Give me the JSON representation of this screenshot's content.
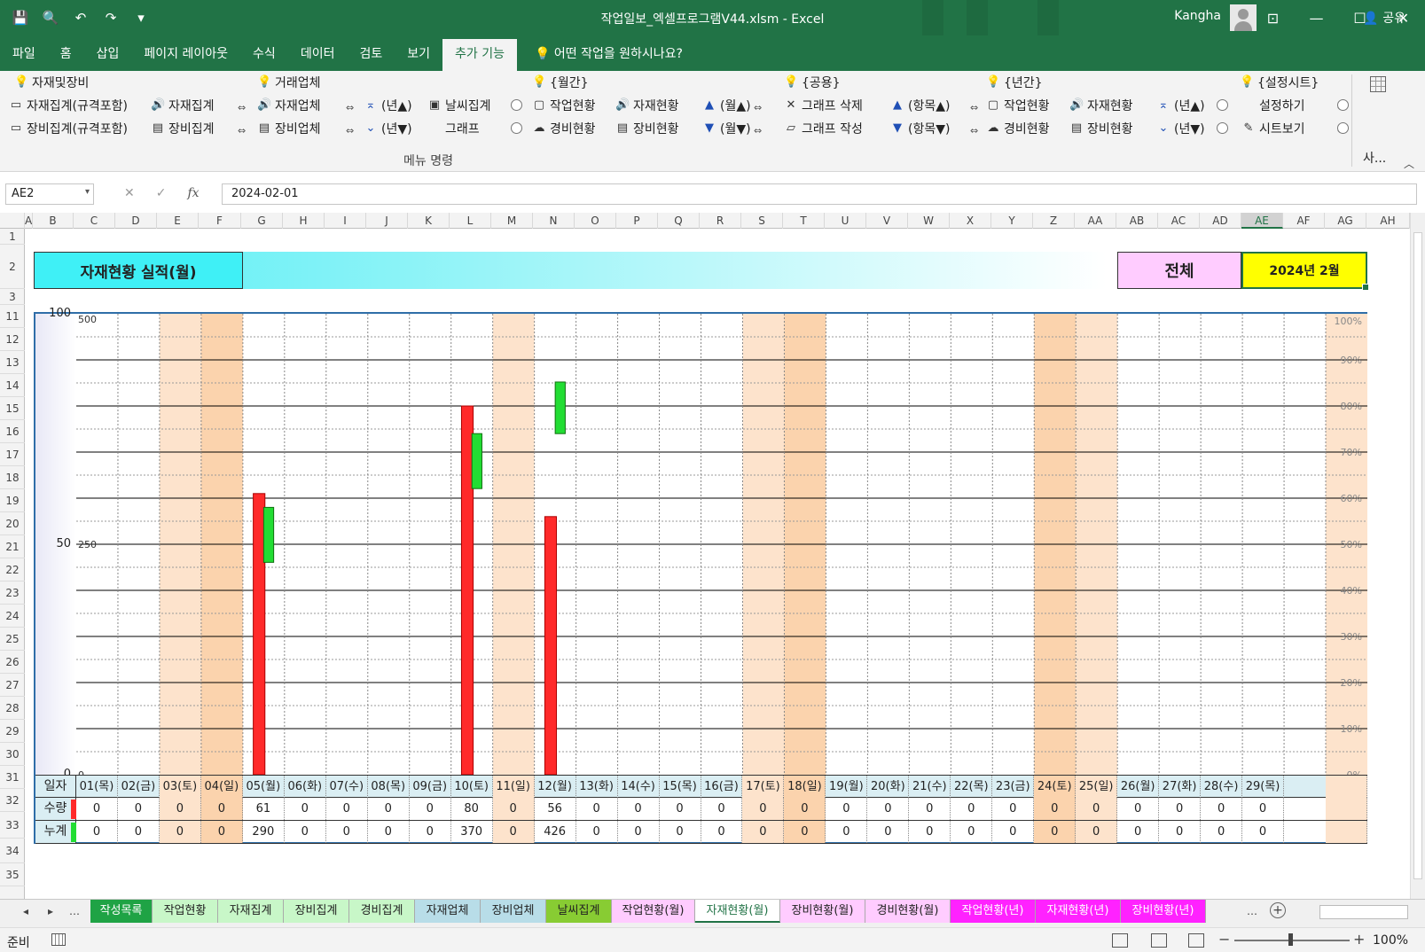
{
  "window": {
    "title": "작업일보_엑셀프로그램V44.xlsm  -  Excel",
    "user": "Kangha"
  },
  "ribbon_tabs": [
    "파일",
    "홈",
    "삽입",
    "페이지 레이아웃",
    "수식",
    "데이터",
    "검토",
    "보기",
    "추가 기능"
  ],
  "tell_me": "어떤 작업을 원하시나요?",
  "share": "공유",
  "ribbon": {
    "group_label": "메뉴 명령",
    "right_label": "사...",
    "headers": [
      {
        "label": "자재및장비",
        "x": 16,
        "icon": "bulb",
        "color": "yel"
      },
      {
        "label": "거래업체",
        "x": 290,
        "icon": "bulb",
        "color": "yel"
      },
      {
        "label": "{월간}",
        "x": 600,
        "icon": "bulb",
        "color": "red"
      },
      {
        "label": "{공용}",
        "x": 884,
        "icon": "bulb",
        "color": "yel"
      },
      {
        "label": "{년간}",
        "x": 1112,
        "icon": "bulb",
        "color": "red"
      },
      {
        "label": "{설정시트}",
        "x": 1398,
        "icon": "bulb",
        "color": "red"
      }
    ],
    "row1": [
      {
        "label": "자재집계(규격포함)",
        "x": 10
      },
      {
        "label": "자재집계",
        "x": 170
      },
      {
        "label": "자재업체",
        "x": 290
      },
      {
        "label": "(년▲)",
        "x": 410
      },
      {
        "label": "날씨집계",
        "x": 482
      },
      {
        "label": "작업현황",
        "x": 600
      },
      {
        "label": "자재현황",
        "x": 694
      },
      {
        "label": "(월▲)",
        "x": 792
      },
      {
        "label": "그래프 삭제",
        "x": 884
      },
      {
        "label": "(항목▲)",
        "x": 1004
      },
      {
        "label": "작업현황",
        "x": 1112
      },
      {
        "label": "자재현황",
        "x": 1206
      },
      {
        "label": "(년▲)",
        "x": 1304
      },
      {
        "label": "설정하기",
        "x": 1420
      }
    ],
    "row2": [
      {
        "label": "장비집계(규격포함)",
        "x": 10
      },
      {
        "label": "장비집계",
        "x": 170
      },
      {
        "label": "장비업체",
        "x": 290
      },
      {
        "label": "(년▼)",
        "x": 410
      },
      {
        "label": "그래프",
        "x": 502
      },
      {
        "label": "경비현황",
        "x": 600
      },
      {
        "label": "장비현황",
        "x": 694
      },
      {
        "label": "(월▼)",
        "x": 792
      },
      {
        "label": "그래프 작성",
        "x": 884
      },
      {
        "label": "(항목▼)",
        "x": 1004
      },
      {
        "label": "경비현황",
        "x": 1112
      },
      {
        "label": "장비현황",
        "x": 1206
      },
      {
        "label": "(년▼)",
        "x": 1304
      },
      {
        "label": "시트보기",
        "x": 1400
      }
    ]
  },
  "formula_bar": {
    "name_box": "AE2",
    "formula": "2024-02-01"
  },
  "columns": [
    "A",
    "B",
    "C",
    "D",
    "E",
    "F",
    "G",
    "H",
    "I",
    "J",
    "K",
    "L",
    "M",
    "N",
    "O",
    "P",
    "Q",
    "R",
    "S",
    "T",
    "U",
    "V",
    "W",
    "X",
    "Y",
    "Z",
    "AA",
    "AB",
    "AC",
    "AD",
    "AE",
    "AF",
    "AG",
    "AH"
  ],
  "rows": [
    "1",
    "2",
    "3",
    "11",
    "12",
    "13",
    "14",
    "15",
    "16",
    "17",
    "18",
    "19",
    "20",
    "21",
    "22",
    "23",
    "24",
    "25",
    "26",
    "27",
    "28",
    "29",
    "30",
    "31",
    "32",
    "33",
    "34",
    "35"
  ],
  "sheet": {
    "title": "자재현황 실적(월)",
    "scope": "전체",
    "period": "2024년 2월"
  },
  "chart_data": {
    "type": "bar",
    "y_left_ticks": [
      "100",
      "50",
      "0"
    ],
    "y_left2_ticks": [
      "500",
      "250",
      "0"
    ],
    "y_right_ticks": [
      "100%",
      "90%",
      "80%",
      "70%",
      "60%",
      "50%",
      "40%",
      "30%",
      "20%",
      "10%",
      "0%"
    ],
    "ylim": [
      0,
      100
    ],
    "ylim_cumulative": [
      0,
      500
    ],
    "categories": [
      "01(목)",
      "02(금)",
      "03(토)",
      "04(일)",
      "05(월)",
      "06(화)",
      "07(수)",
      "08(목)",
      "09(금)",
      "10(토)",
      "11(일)",
      "12(월)",
      "13(화)",
      "14(수)",
      "15(목)",
      "16(금)",
      "17(토)",
      "18(일)",
      "19(월)",
      "20(화)",
      "21(수)",
      "22(목)",
      "23(금)",
      "24(토)",
      "25(일)",
      "26(월)",
      "27(화)",
      "28(수)",
      "29(목)"
    ],
    "weekend_index": [
      2,
      3,
      10,
      16,
      17,
      23,
      24
    ],
    "series": [
      {
        "name": "수량",
        "color": "#ff2a2a",
        "values": [
          0,
          0,
          0,
          0,
          61,
          0,
          0,
          0,
          0,
          80,
          0,
          56,
          0,
          0,
          0,
          0,
          0,
          0,
          0,
          0,
          0,
          0,
          0,
          0,
          0,
          0,
          0,
          0,
          0
        ]
      },
      {
        "name": "누계",
        "color": "#22dd33",
        "values": [
          0,
          0,
          0,
          0,
          290,
          0,
          0,
          0,
          0,
          370,
          0,
          426,
          0,
          0,
          0,
          0,
          0,
          0,
          0,
          0,
          0,
          0,
          0,
          0,
          0,
          0,
          0,
          0,
          0
        ]
      }
    ],
    "green_bar_span": [
      {
        "index": 4,
        "from": 0,
        "to": 290
      },
      {
        "index": 9,
        "from": 290,
        "to": 370
      },
      {
        "index": 11,
        "from": 370,
        "to": 426
      }
    ],
    "header_label": "일자"
  },
  "sheet_tabs": [
    {
      "label": "작성목록",
      "bg": "#1fa345",
      "fg": "#fff"
    },
    {
      "label": "작업현황",
      "bg": "#c8f7c8",
      "fg": "#222"
    },
    {
      "label": "자재집계",
      "bg": "#c8f7c8",
      "fg": "#222"
    },
    {
      "label": "장비집계",
      "bg": "#c8f7c8",
      "fg": "#222"
    },
    {
      "label": "경비집계",
      "bg": "#c8f7c8",
      "fg": "#222"
    },
    {
      "label": "자재업체",
      "bg": "#b8dde8",
      "fg": "#222"
    },
    {
      "label": "장비업체",
      "bg": "#b8dde8",
      "fg": "#222"
    },
    {
      "label": "날씨집계",
      "bg": "#88cc33",
      "fg": "#222"
    },
    {
      "label": "작업현황(월)",
      "bg": "#ffccff",
      "fg": "#222"
    },
    {
      "label": "자재현황(월)",
      "bg": "#ffffff",
      "fg": "#217346",
      "active": true
    },
    {
      "label": "장비현황(월)",
      "bg": "#ffccff",
      "fg": "#222"
    },
    {
      "label": "경비현황(월)",
      "bg": "#ffccff",
      "fg": "#222"
    },
    {
      "label": "작업현황(년)",
      "bg": "#ff22ff",
      "fg": "#fff"
    },
    {
      "label": "자재현황(년)",
      "bg": "#ff22ff",
      "fg": "#fff"
    },
    {
      "label": "장비현황(년)",
      "bg": "#ff22ff",
      "fg": "#fff"
    }
  ],
  "status": {
    "ready": "준비",
    "zoom": "100%"
  }
}
